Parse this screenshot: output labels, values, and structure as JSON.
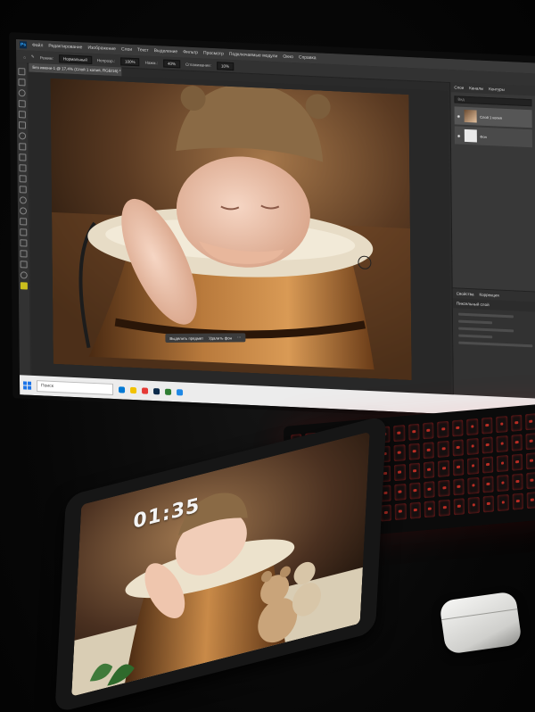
{
  "photoshop": {
    "logo": "Ps",
    "menu": [
      "Файл",
      "Редактирование",
      "Изображение",
      "Слои",
      "Текст",
      "Выделение",
      "Фильтр",
      "Просмотр",
      "Подключаемые модули",
      "Окно",
      "Справка"
    ],
    "options": {
      "mode_label": "Режим:",
      "mode_value": "Нормальный",
      "opacity_label": "Непрозр.:",
      "opacity_value": "100%",
      "pressure_label": "Нажм.:",
      "pressure_value": "40%",
      "smoothing_label": "Сглаживание:",
      "smoothing_value": "10%"
    },
    "document_tab": "Без имени-1 @ 17,4% (Слой 1 копия, RGB/16) *",
    "panels": {
      "tabs": [
        "Слои",
        "Каналы",
        "Контуры"
      ],
      "search": "Вид",
      "layers": [
        {
          "name": "Слой 1 копия",
          "selected": true
        },
        {
          "name": "Фон",
          "selected": false
        }
      ],
      "properties_tabs": [
        "Свойства",
        "Коррекция"
      ],
      "properties_title": "Пиксельный слой"
    },
    "context_bar": [
      "Выделить предмет",
      "Удалить фон"
    ],
    "taskbar": {
      "search_placeholder": "Поиск"
    }
  },
  "tablet": {
    "clock": "01:35"
  },
  "colors": {
    "ps_dark": "#2a2a2a",
    "ps_accent": "#31a8ff",
    "keyboard_glow": "#ff3b2e",
    "taskbar": "#ececec"
  }
}
